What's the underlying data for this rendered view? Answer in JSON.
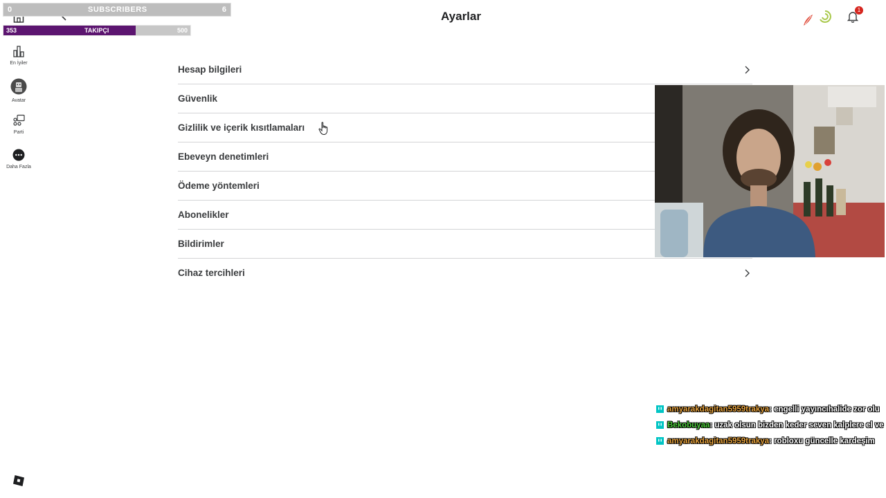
{
  "overlay": {
    "subscribers": {
      "min": "0",
      "label": "SUBSCRIBERS",
      "max": "6"
    },
    "followers": {
      "current": "353",
      "label": "TAKIPÇI",
      "max": "500",
      "progress": 0.706,
      "fill_color": "#5c1570"
    }
  },
  "sidebar": {
    "items": [
      {
        "label": "En İyiler",
        "icon": "chart-icon"
      },
      {
        "label": "Avatar",
        "icon": "avatar-icon"
      },
      {
        "label": "Parti",
        "icon": "party-icon"
      },
      {
        "label": "Daha Fazla",
        "icon": "more-icon"
      }
    ]
  },
  "header": {
    "title": "Ayarlar",
    "notifications_count": "1"
  },
  "settings": {
    "items": [
      {
        "label": "Hesap bilgileri"
      },
      {
        "label": "Güvenlik"
      },
      {
        "label": "Gizlilik ve içerik kısıtlamaları"
      },
      {
        "label": "Ebeveyn denetimleri"
      },
      {
        "label": "Ödeme yöntemleri"
      },
      {
        "label": "Abonelikler"
      },
      {
        "label": "Bildirimler"
      },
      {
        "label": "Cihaz tercihleri"
      }
    ]
  },
  "chat": {
    "messages": [
      {
        "user": "amyarakdagitan5959trakya",
        "user_color": "#e8a33d",
        "text": " : engelli yayıncıhalide zor olu"
      },
      {
        "user": "Bekobuyaa",
        "user_color": "#4ccd3b",
        "text": " : uzak olsun bizden keder seven kalplere el ve"
      },
      {
        "user": "amyarakdagitan5959trakya",
        "user_color": "#e8a33d",
        "text": " : robloxu güncelle kardeşim"
      }
    ]
  }
}
